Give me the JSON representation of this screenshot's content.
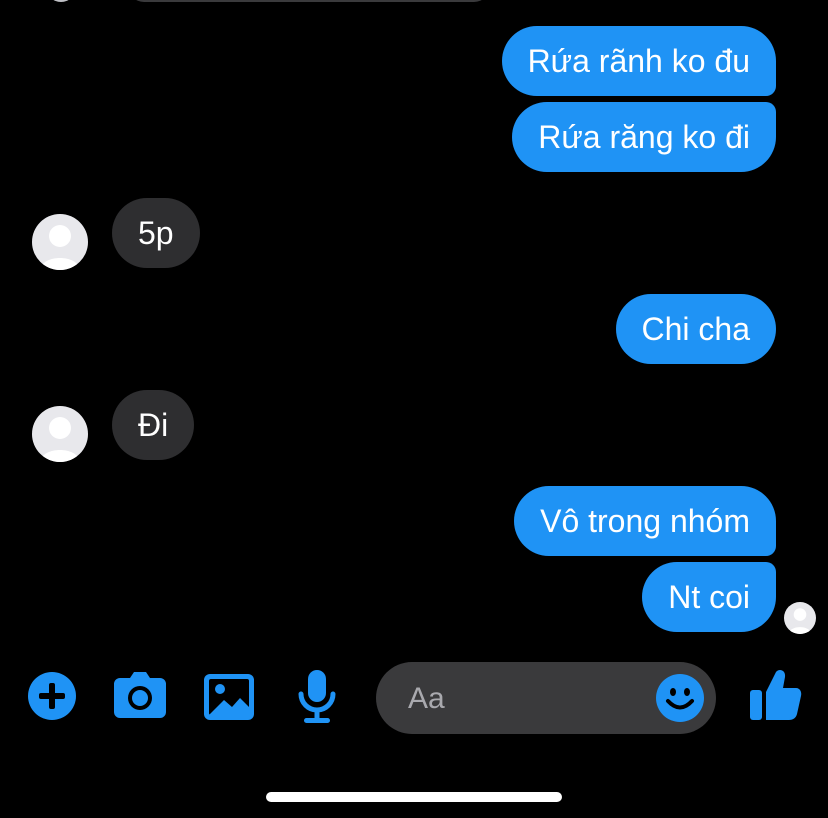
{
  "messages": [
    {
      "side": "outgoing",
      "text": "Rứa rãnh ko đu"
    },
    {
      "side": "outgoing",
      "text": "Rứa răng ko đi"
    },
    {
      "side": "incoming",
      "text": "5p"
    },
    {
      "side": "outgoing",
      "text": "Chi cha"
    },
    {
      "side": "incoming",
      "text": "Đi"
    },
    {
      "side": "outgoing",
      "text": "Vô trong nhóm"
    },
    {
      "side": "outgoing",
      "text": "Nt coi"
    }
  ],
  "composer": {
    "placeholder": "Aa",
    "value": ""
  },
  "toolbar": {
    "icons": [
      "add-icon",
      "camera-icon",
      "gallery-icon",
      "microphone-icon",
      "emoji-icon",
      "thumbs-up-icon"
    ]
  },
  "colors": {
    "background": "#000000",
    "outgoing_bubble": "#1f93f5",
    "incoming_bubble": "#2e2e30",
    "composer": "#3a3a3c",
    "accent": "#1f93f5"
  }
}
